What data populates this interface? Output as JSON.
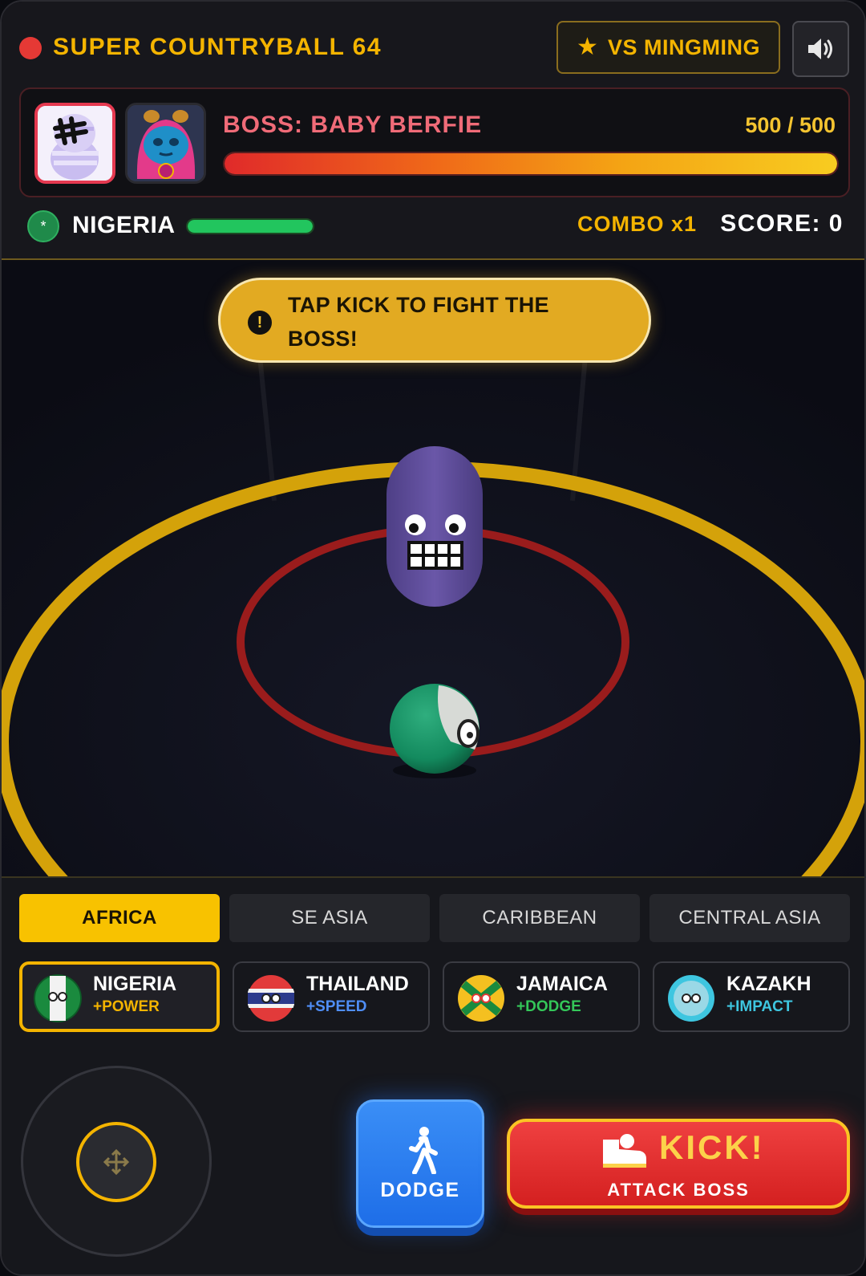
{
  "header": {
    "game_title": "SUPER COUNTRYBALL 64",
    "vs_label": "VS MINGMING",
    "accent_color": "#f4b400"
  },
  "boss": {
    "name": "BOSS: BABY BERFIE",
    "hp_text": "500 / 500",
    "hp_fraction": 1.0
  },
  "player": {
    "name": "NIGERIA",
    "badge_glyph": "*",
    "hp_fraction": 1.0,
    "combo": "COMBO x1",
    "score": "SCORE: 0"
  },
  "hint": {
    "text": "TAP KICK TO FIGHT THE BOSS!",
    "icon_glyph": "!"
  },
  "tabs": [
    {
      "label": "AFRICA",
      "active": true
    },
    {
      "label": "SE ASIA",
      "active": false
    },
    {
      "label": "CARIBBEAN",
      "active": false
    },
    {
      "label": "CENTRAL ASIA",
      "active": false
    }
  ],
  "teams": [
    {
      "name": "NIGERIA",
      "bonus": "+POWER",
      "bonus_color": "#f4b400",
      "ball_icon": "nigeria-ball-icon",
      "selected": true
    },
    {
      "name": "THAILAND",
      "bonus": "+SPEED",
      "bonus_color": "#4f8ef7",
      "ball_icon": "thailand-ball-icon",
      "selected": false
    },
    {
      "name": "JAMAICA",
      "bonus": "+DODGE",
      "bonus_color": "#34c759",
      "ball_icon": "jamaica-ball-icon",
      "selected": false
    },
    {
      "name": "KAZAKH",
      "bonus": "+IMPACT",
      "bonus_color": "#3ec6e0",
      "ball_icon": "kazakh-ball-icon",
      "selected": false
    }
  ],
  "actions": {
    "dodge_label": "DODGE",
    "kick_label": "KICK!",
    "kick_sub": "ATTACK BOSS"
  }
}
